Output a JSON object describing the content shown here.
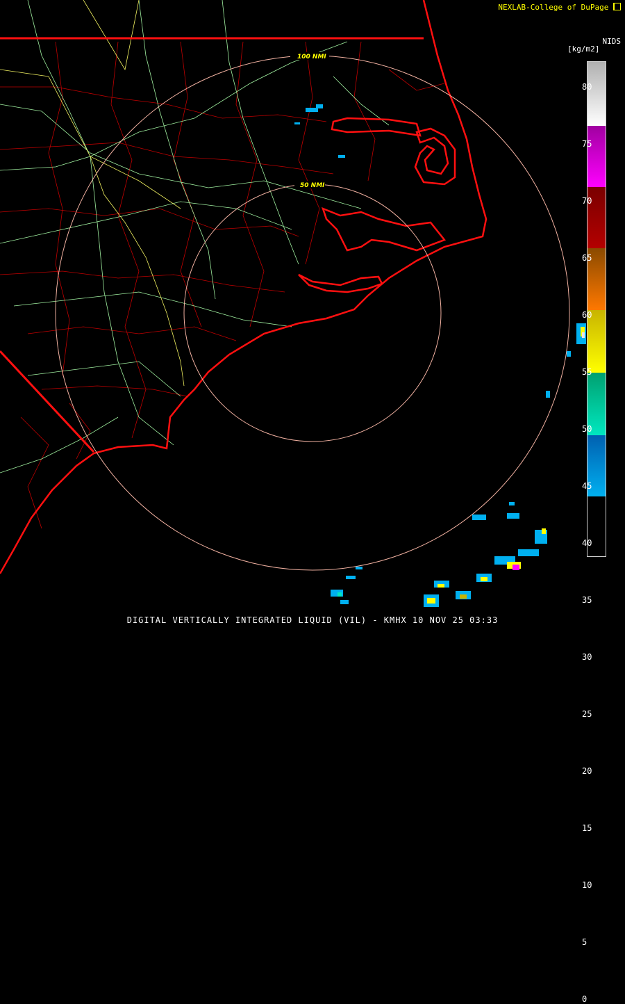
{
  "header": {
    "credit": "NEXLAB-College of DuPage",
    "credit_icon": "dupage-logo-icon",
    "product": "NIDS",
    "unit": "[kg/m2]"
  },
  "legend": {
    "ticks": [
      "80",
      "75",
      "70",
      "65",
      "60",
      "55",
      "50",
      "45",
      "40",
      "35",
      "30",
      "25",
      "20",
      "15",
      "10",
      "5",
      "0"
    ],
    "colors": {
      "white": "#e8e8e8",
      "magenta": "#ff00ff",
      "dark_magenta": "#a000a0",
      "red": "#b40000",
      "dark_red": "#7a0000",
      "brown": "#8a4a00",
      "orange": "#ff7800",
      "yellow": "#ffff00",
      "olive": "#c8b400",
      "teal": "#00a070",
      "aqua": "#00e8c0",
      "blue": "#0060b0",
      "cyan": "#00b0f0"
    }
  },
  "rings": {
    "inner_label": "50 NMI",
    "outer_label": "100 NMI",
    "color": "#f0b0a0"
  },
  "map_colors": {
    "coast": "#ff1010",
    "state_line": "#ff1010",
    "county": "#c00000",
    "roads": "#a0f0a0",
    "highway": "#f0f060"
  },
  "footer": {
    "title": "DIGITAL VERTICALLY INTEGRATED LIQUID (VIL) - KMHX 10 NOV 25 03:33"
  }
}
